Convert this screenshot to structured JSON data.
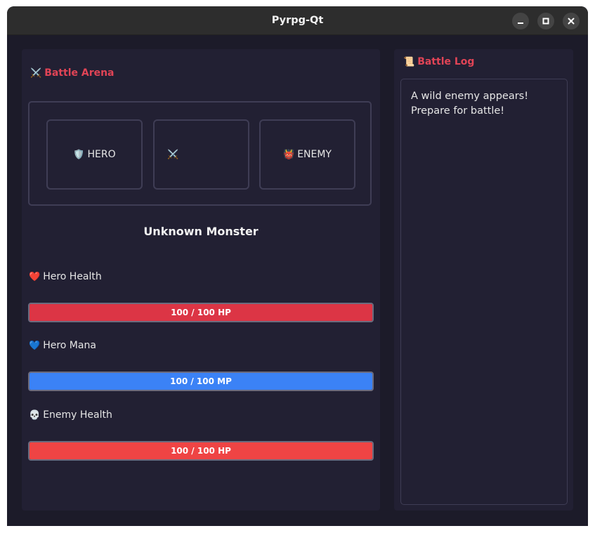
{
  "window": {
    "title": "Pyrpg-Qt",
    "buttons": [
      "minimize-icon",
      "maximize-icon",
      "close-icon"
    ]
  },
  "arena": {
    "icon": "⚔️",
    "title": "Battle Arena",
    "hero_icon": "🛡️",
    "hero_label": "HERO",
    "vs_icon": "⚔️",
    "enemy_icon": "👹",
    "enemy_label": "ENEMY",
    "monster_name": "Unknown Monster"
  },
  "stats": {
    "hero_health": {
      "icon": "❤️",
      "label": "Hero Health",
      "text": "100 / 100 HP",
      "value": 100,
      "max": 100,
      "color": "#dc3545"
    },
    "hero_mana": {
      "icon": "💙",
      "label": "Hero Mana",
      "text": "100 / 100 MP",
      "value": 100,
      "max": 100,
      "color": "#3b82f6"
    },
    "enemy_health": {
      "icon": "💀",
      "label": "Enemy Health",
      "text": "100 / 100 HP",
      "value": 100,
      "max": 100,
      "color": "#ef4444"
    }
  },
  "log": {
    "icon": "📜",
    "title": "Battle Log",
    "lines": [
      "A wild enemy appears!",
      "Prepare for battle!"
    ]
  },
  "colors": {
    "accent": "#e14456",
    "background": "#1c1b29",
    "panel": "#222033"
  }
}
